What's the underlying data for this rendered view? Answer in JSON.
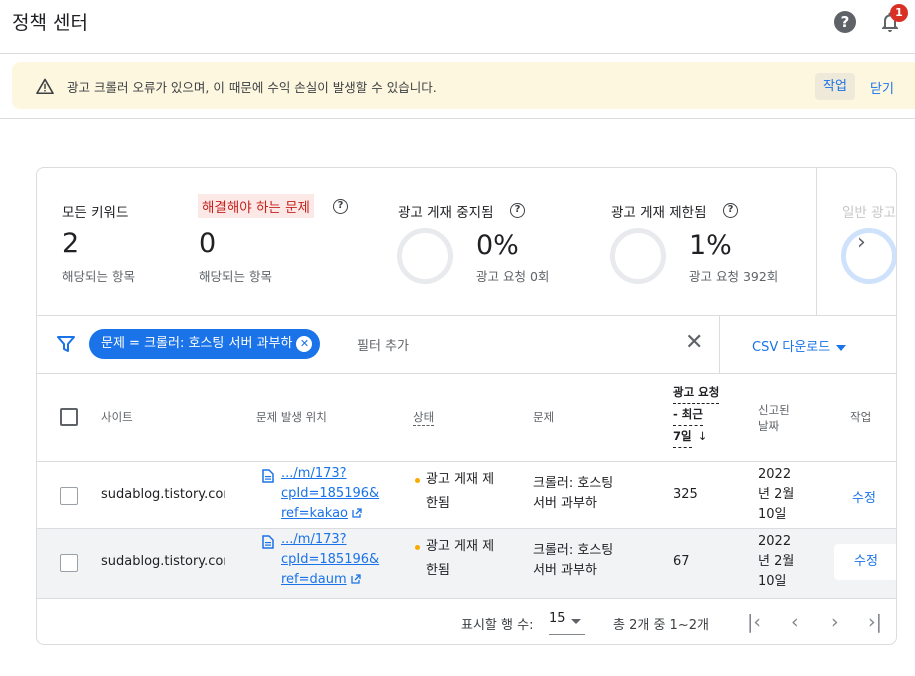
{
  "header": {
    "title": "정책 센터",
    "help_glyph": "?",
    "notification_count": "1"
  },
  "alert": {
    "message": "광고 크롤러 오류가 있으며, 이 때문에 수익 손실이 발생할 수 있습니다.",
    "action_label": "작업",
    "close_label": "닫기",
    "accent_color": "#fef7e0"
  },
  "summary": {
    "all_keywords": {
      "label": "모든 키워드",
      "value": "2",
      "sub": "해당되는 항목"
    },
    "issues": {
      "label": "해결해야 하는 문제",
      "value": "0",
      "sub": "해당되는 항목"
    },
    "suspended": {
      "label": "광고 게재 중지됨",
      "value": "0%",
      "sub": "광고 요청 0회"
    },
    "restricted": {
      "label": "광고 게재 제한됨",
      "value": "1%",
      "sub": "광고 요청 392회"
    },
    "general": {
      "label": "일반 광고"
    }
  },
  "filter": {
    "chip_label": "문제 = 크롤러: 호스팅 서버 과부하",
    "add_filter_label": "필터 추가",
    "csv_label": "CSV 다운로드"
  },
  "table": {
    "headers": {
      "site": "사이트",
      "location": "문제 발생 위치",
      "status": "상태",
      "issue": "문제",
      "requests_line1": "광고 요청",
      "requests_line2": "- 최근",
      "requests_line3": "7일",
      "reported_line1": "신고된",
      "reported_line2": "날짜",
      "action": "작업"
    },
    "rows": [
      {
        "site": "sudablog.tistory.com",
        "link1": ".../m/173?",
        "link2": "cpId=185196&",
        "link3": "ref=kakao",
        "status1": "광고 게재 제",
        "status2": "한됨",
        "issue1": "크롤러: 호스팅",
        "issue2": "서버 과부하",
        "requests": "325",
        "date1": "2022",
        "date2": "년 2월",
        "date3": "10일",
        "action": "수정"
      },
      {
        "site": "sudablog.tistory.com",
        "link1": ".../m/173?",
        "link2": "cpId=185196&",
        "link3": "ref=daum",
        "status1": "광고 게재 제",
        "status2": "한됨",
        "issue1": "크롤러: 호스팅",
        "issue2": "서버 과부하",
        "requests": "67",
        "date1": "2022",
        "date2": "년 2월",
        "date3": "10일",
        "action": "수정"
      }
    ]
  },
  "pagination": {
    "rows_label": "표시할 행 수:",
    "rows_value": "15",
    "range_label": "총 2개 중 1~2개"
  }
}
